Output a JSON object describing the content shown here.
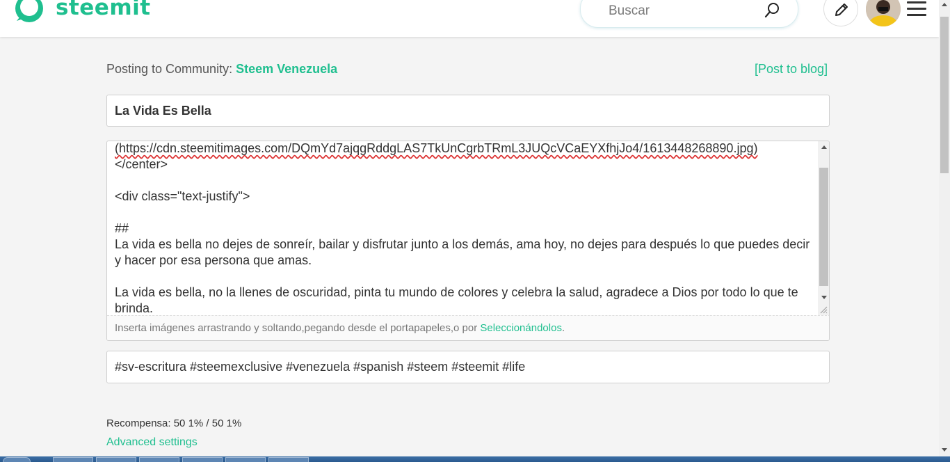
{
  "brand": {
    "name": "steemit",
    "color": "#1fbf8f"
  },
  "search": {
    "placeholder": "Buscar"
  },
  "posting": {
    "prefix": "Posting to Community:",
    "community": "Steem Venezuela",
    "post_to_blog": "[Post to blog]"
  },
  "title": {
    "value": "La Vida Es Bella"
  },
  "editor": {
    "lines": {
      "l1": "(https://cdn.steemitimages.com/DQmYd7ajqgRddgLAS7TkUnCgrbTRmL3JUQcVCaEYXfhjJo4/1613448268890.jpg)",
      "l2": "</center>",
      "l3": "",
      "l4": "<div class=\"text-justify\">",
      "l5": "",
      "l6": "##",
      "p1": "La vida es bella no dejes de sonreír, bailar y disfrutar junto a los demás, ama hoy, no dejes para después lo que puedes decir y hacer por esa persona que amas.",
      "l7": "",
      "p2": "La vida es bella, no la llenes de oscuridad, pinta tu mundo de colores y celebra la salud, agradece a Dios por todo lo que te brinda."
    },
    "dropzone_text": "Inserta imágenes arrastrando y soltando,pegando desde el portapapeles,o por ",
    "dropzone_link": "Seleccionándolos",
    "dropzone_end": "."
  },
  "tags": {
    "value": "#sv-escritura #steemexclusive #venezuela #spanish #steem #steemit #life"
  },
  "reward": {
    "text": "Recompensa: 50 1% / 50 1%"
  },
  "advanced": {
    "label": "Advanced settings"
  },
  "icons": {
    "logo": "steemit-logo-icon",
    "search": "search-icon",
    "pencil": "pencil-icon",
    "menu": "hamburger-menu-icon"
  }
}
